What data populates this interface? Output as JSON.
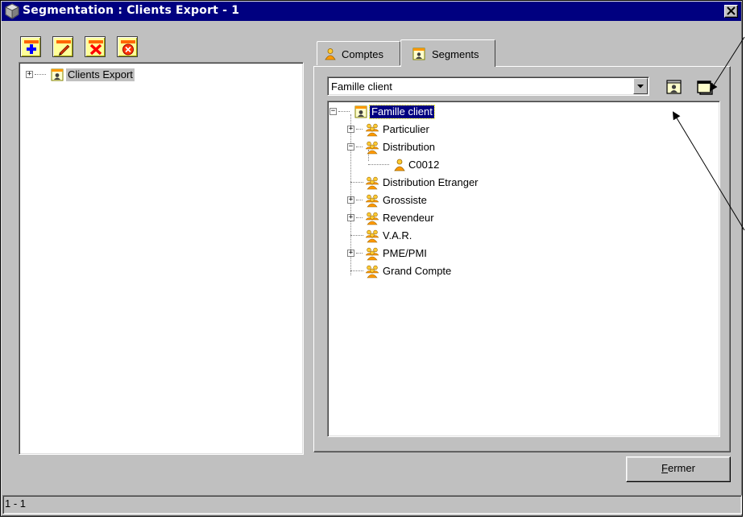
{
  "window": {
    "title": "Segmentation : Clients Export - 1",
    "close_glyph": "✕"
  },
  "toolbar": {
    "buttons": [
      {
        "name": "add",
        "icon": "plus-icon",
        "color": "#0000ff"
      },
      {
        "name": "edit",
        "icon": "pencil-icon",
        "color": "#cc0000"
      },
      {
        "name": "delete",
        "icon": "red-x-icon",
        "color": "#ff0000"
      },
      {
        "name": "cancel",
        "icon": "no-entry-icon",
        "color": "#ff0000"
      }
    ]
  },
  "left_tree": {
    "expander": "+",
    "root_label": "Clients Export"
  },
  "tabs": [
    {
      "label": "Comptes",
      "icon": "person-icon",
      "active": false
    },
    {
      "label": "Segments",
      "icon": "segment-icon",
      "active": true
    }
  ],
  "segments": {
    "dropdown_value": "Famille client",
    "root": {
      "label": "Famille client",
      "expander": "−"
    },
    "nodes": [
      {
        "label": "Particulier",
        "expander": "+",
        "icon": "group-icon"
      },
      {
        "label": "Distribution",
        "expander": "−",
        "icon": "group-icon"
      },
      {
        "label": "C0012",
        "expander": "",
        "icon": "person-icon"
      },
      {
        "label": "Distribution Etranger",
        "expander": "",
        "icon": "group-icon"
      },
      {
        "label": "Grossiste",
        "expander": "+",
        "icon": "group-icon"
      },
      {
        "label": "Revendeur",
        "expander": "+",
        "icon": "group-icon"
      },
      {
        "label": "V.A.R.",
        "expander": "",
        "icon": "group-icon"
      },
      {
        "label": "PME/PMI",
        "expander": "+",
        "icon": "group-icon"
      },
      {
        "label": "Grand Compte",
        "expander": "",
        "icon": "group-icon"
      }
    ]
  },
  "buttons": {
    "fermer_first": "F",
    "fermer_rest": "ermer"
  },
  "status": {
    "text": "1 - 1"
  },
  "colors": {
    "titlebar": "#000080",
    "face": "#c0c0c0",
    "toolbar_bg": "#ffff99",
    "selection": "#000080"
  }
}
